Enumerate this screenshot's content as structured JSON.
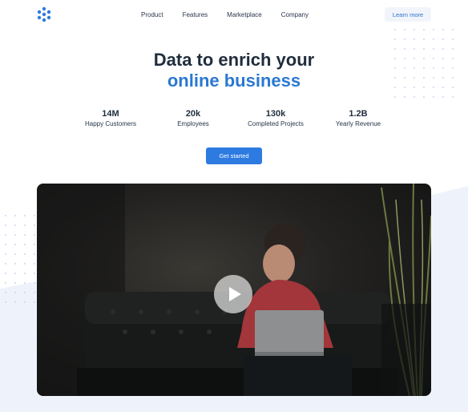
{
  "nav": {
    "logo_icon": "dots-cluster-logo-icon",
    "links": [
      "Product",
      "Features",
      "Marketplace",
      "Company"
    ],
    "learn_more": "Learn more"
  },
  "hero": {
    "title_line1": "Data to enrich your",
    "title_line2": "online business",
    "cta": "Get started"
  },
  "stats": [
    {
      "value": "14M",
      "label": "Happy Customers"
    },
    {
      "value": "20k",
      "label": "Employees"
    },
    {
      "value": "130k",
      "label": "Completed Projects"
    },
    {
      "value": "1.2B",
      "label": "Yearly Revenue"
    }
  ],
  "video": {
    "play_icon": "play-icon"
  },
  "colors": {
    "accent": "#2d7be0",
    "title_dark": "#1f2d3d",
    "title_accent": "#2a78d2",
    "bg_wave": "#eef3fb"
  }
}
